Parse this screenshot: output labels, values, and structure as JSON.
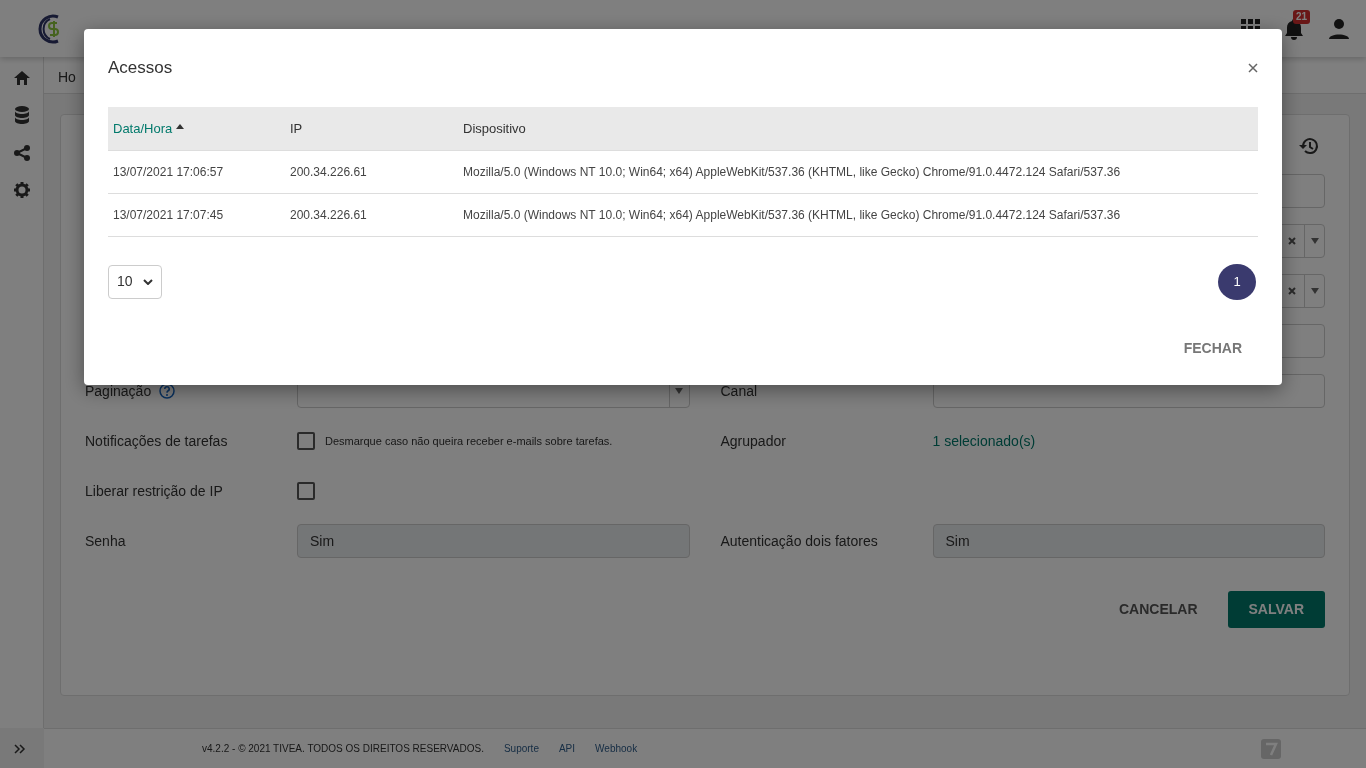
{
  "header": {
    "notification_count": "21"
  },
  "breadcrumb": "Ho",
  "form": {
    "partial_fields": [
      {
        "kind": "input"
      },
      {
        "kind": "select"
      },
      {
        "kind": "select"
      },
      {
        "kind": "input"
      }
    ],
    "rows": [
      [
        {
          "label": "Paginação",
          "kind": "select",
          "help": true
        },
        {
          "label": "Canal",
          "kind": "input"
        }
      ],
      [
        {
          "label": "Notificações de tarefas",
          "kind": "checkbox",
          "checked": false,
          "note": "Desmarque caso não queira receber e-mails sobre tarefas."
        },
        {
          "label": "Agrupador",
          "kind": "link",
          "value": "1 selecionado(s)"
        }
      ],
      [
        {
          "label": "Liberar restrição de IP",
          "kind": "checkbox",
          "checked": false
        }
      ],
      [
        {
          "label": "Senha",
          "kind": "readonly",
          "value": "Sim"
        },
        {
          "label": "Autenticação dois fatores",
          "kind": "readonly",
          "value": "Sim"
        }
      ]
    ],
    "cancel_button": "CANCELAR",
    "save_button": "SALVAR"
  },
  "footer": {
    "text": "v4.2.2 - © 2021 TIVEA. TODOS OS DIREITOS RESERVADOS.",
    "links": [
      "Suporte",
      "API",
      "Webhook"
    ]
  },
  "modal": {
    "title": "Acessos",
    "columns": [
      {
        "label": "Data/Hora",
        "sorted": true
      },
      {
        "label": "IP",
        "sorted": false
      },
      {
        "label": "Dispositivo",
        "sorted": false
      }
    ],
    "rows": [
      [
        "13/07/2021 17:06:57",
        "200.34.226.61",
        "Mozilla/5.0 (Windows NT 10.0; Win64; x64) AppleWebKit/537.36 (KHTML, like Gecko) Chrome/91.0.4472.124 Safari/537.36"
      ],
      [
        "13/07/2021 17:07:45",
        "200.34.226.61",
        "Mozilla/5.0 (Windows NT 10.0; Win64; x64) AppleWebKit/537.36 (KHTML, like Gecko) Chrome/91.0.4472.124 Safari/537.36"
      ]
    ],
    "page_size": "10",
    "pages": [
      {
        "label": "1",
        "selected": true
      }
    ],
    "close_button": "FECHAR"
  }
}
